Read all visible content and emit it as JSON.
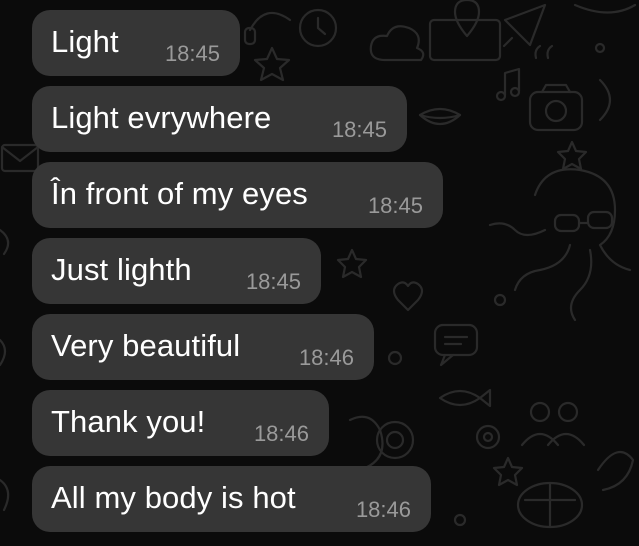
{
  "chat": {
    "messages": [
      {
        "text": "Light",
        "time": "18:45"
      },
      {
        "text": "Light evrywhere",
        "time": "18:45"
      },
      {
        "text": "În front of my eyes",
        "time": "18:45"
      },
      {
        "text": "Just lighth",
        "time": "18:45"
      },
      {
        "text": "Very beautiful",
        "time": "18:46"
      },
      {
        "text": "Thank you!",
        "time": "18:46"
      },
      {
        "text": "All my body is hot",
        "time": "18:46"
      }
    ]
  },
  "colors": {
    "background": "#0b0b0b",
    "bubble": "#363636",
    "message_text": "#ffffff",
    "timestamp_text": "#9a9a9a",
    "doodle_lines": "#2a2a2a"
  },
  "icons": [
    "camera-icon",
    "clock-icon",
    "rocket-icon",
    "cloud-icon",
    "star-icon",
    "heart-icon",
    "octopus-icon",
    "sunglasses-icon",
    "music-note-icon",
    "chat-bubble-icon",
    "fish-icon",
    "gear-icon",
    "people-icon",
    "cactus-icon",
    "turtle-icon",
    "lips-icon",
    "envelope-icon",
    "quote-icon",
    "map-pin-icon",
    "headphones-icon"
  ]
}
